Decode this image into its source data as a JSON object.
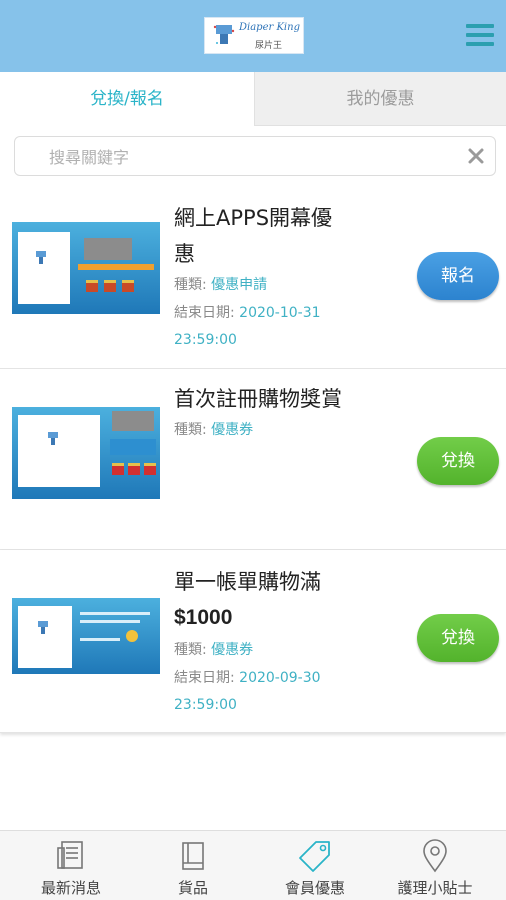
{
  "header": {
    "logo_brand": "Diaper King",
    "logo_brand_cn": "尿片王",
    "menu_icon": "hamburger-menu-icon"
  },
  "tabs": [
    {
      "label": "兌換/報名",
      "active": true
    },
    {
      "label": "我的優惠",
      "active": false
    }
  ],
  "search": {
    "placeholder": "搜尋關鍵字",
    "value": "",
    "clear_icon": "close-icon"
  },
  "offers": [
    {
      "title_line1": "網上APPS開幕優",
      "title_line2": "惠",
      "type_label": "種類:",
      "type_value": "優惠申請",
      "end_label": "結束日期:",
      "end_date": "2020-10-31",
      "end_time": "23:59:00",
      "button": "報名",
      "button_color": "#2c83cf"
    },
    {
      "title_line1": "首次註冊購物獎賞",
      "type_label": "種類:",
      "type_value": "優惠券",
      "button": "兌換",
      "button_color": "#53b32c"
    },
    {
      "title_line1": "單一帳單購物滿",
      "title_line2": "$1000",
      "type_label": "種類:",
      "type_value": "優惠券",
      "end_label": "結束日期:",
      "end_date": "2020-09-30",
      "end_time": "23:59:00",
      "button": "兌換",
      "button_color": "#53b32c"
    }
  ],
  "bottom_nav": [
    {
      "label": "最新消息",
      "icon": "newspaper-icon"
    },
    {
      "label": "貨品",
      "icon": "book-icon"
    },
    {
      "label": "會員優惠",
      "icon": "tag-icon"
    },
    {
      "label": "護理小貼士",
      "icon": "location-pin-icon"
    }
  ],
  "colors": {
    "header_bg": "#86c2ea",
    "accent_teal": "#2ab4c8",
    "button_blue": "#2c83cf",
    "button_green": "#53b32c"
  }
}
